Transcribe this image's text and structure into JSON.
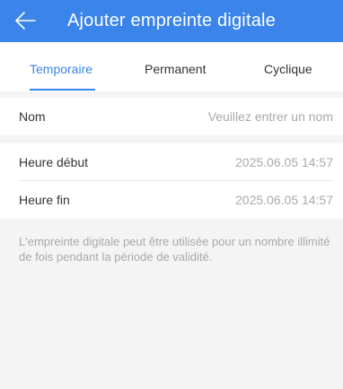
{
  "header": {
    "title": "Ajouter empreinte digitale",
    "back_icon": "arrow-left-icon",
    "background_color": "#3a84ea"
  },
  "tabs": [
    {
      "label": "Temporaire",
      "active": true
    },
    {
      "label": "Permanent",
      "active": false
    },
    {
      "label": "Cyclique",
      "active": false
    }
  ],
  "form": {
    "name": {
      "label": "Nom",
      "value": "",
      "placeholder": "Veuillez entrer un nom"
    },
    "start_time": {
      "label": "Heure début",
      "value": "2025.06.05 14:57"
    },
    "end_time": {
      "label": "Heure fin",
      "value": "2025.06.05 14:57"
    }
  },
  "note": "L'empreinte digitale peut être utilisée pour un nombre illimité de fois pendant la période de validité."
}
